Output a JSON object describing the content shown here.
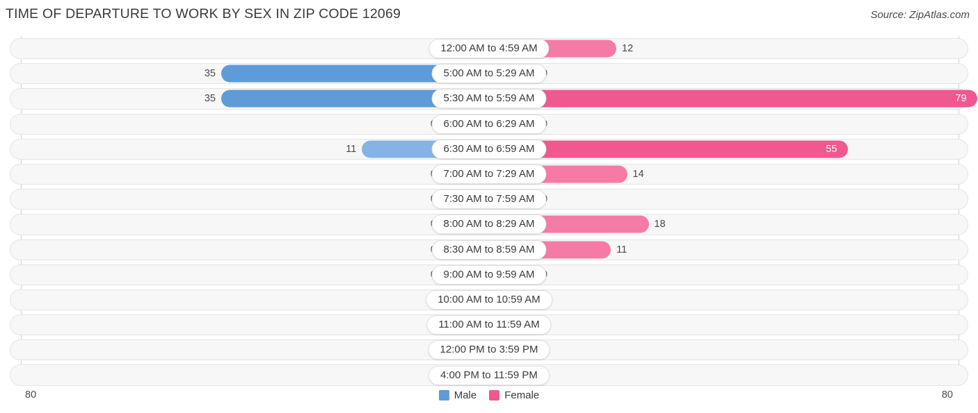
{
  "header": {
    "title": "TIME OF DEPARTURE TO WORK BY SEX IN ZIP CODE 12069",
    "source": "Source: ZipAtlas.com"
  },
  "legend": {
    "items": [
      {
        "label": "Male",
        "color": "#5E9BD8"
      },
      {
        "label": "Female",
        "color": "#F0588F"
      }
    ]
  },
  "axis": {
    "left_end": "80",
    "right_end": "80"
  },
  "colors": {
    "male_strong": "#5E9BD8",
    "male_light": "#A8C8EC",
    "female_strong": "#F0588F",
    "female_mid": "#F57BA6",
    "female_light": "#F9A8C4",
    "track": "#f7f7f7",
    "track_border": "#e4e4e4",
    "axis": "#cfcfcf"
  },
  "chart_data": {
    "type": "bar",
    "orientation": "horizontal",
    "style": "diverging-butterfly",
    "title": "TIME OF DEPARTURE TO WORK BY SEX IN ZIP CODE 12069",
    "xlabel": "",
    "ylabel": "",
    "xlim": [
      80,
      80
    ],
    "grid": false,
    "legend_position": "bottom-center",
    "categories": [
      "12:00 AM to 4:59 AM",
      "5:00 AM to 5:29 AM",
      "5:30 AM to 5:59 AM",
      "6:00 AM to 6:29 AM",
      "6:30 AM to 6:59 AM",
      "7:00 AM to 7:29 AM",
      "7:30 AM to 7:59 AM",
      "8:00 AM to 8:29 AM",
      "8:30 AM to 8:59 AM",
      "9:00 AM to 9:59 AM",
      "10:00 AM to 10:59 AM",
      "11:00 AM to 11:59 AM",
      "12:00 PM to 3:59 PM",
      "4:00 PM to 11:59 PM"
    ],
    "series": [
      {
        "name": "Male",
        "values": [
          0,
          35,
          35,
          0,
          11,
          0,
          0,
          0,
          0,
          0,
          0,
          0,
          0,
          0
        ]
      },
      {
        "name": "Female",
        "values": [
          12,
          0,
          79,
          0,
          55,
          14,
          0,
          18,
          11,
          0,
          0,
          0,
          0,
          0
        ]
      }
    ]
  },
  "rows": [
    {
      "category": "12:00 AM to 4:59 AM",
      "male": "0",
      "female": "12"
    },
    {
      "category": "5:00 AM to 5:29 AM",
      "male": "35",
      "female": "0"
    },
    {
      "category": "5:30 AM to 5:59 AM",
      "male": "35",
      "female": "79"
    },
    {
      "category": "6:00 AM to 6:29 AM",
      "male": "0",
      "female": "0"
    },
    {
      "category": "6:30 AM to 6:59 AM",
      "male": "11",
      "female": "55"
    },
    {
      "category": "7:00 AM to 7:29 AM",
      "male": "0",
      "female": "14"
    },
    {
      "category": "7:30 AM to 7:59 AM",
      "male": "0",
      "female": "0"
    },
    {
      "category": "8:00 AM to 8:29 AM",
      "male": "0",
      "female": "18"
    },
    {
      "category": "8:30 AM to 8:59 AM",
      "male": "0",
      "female": "11"
    },
    {
      "category": "9:00 AM to 9:59 AM",
      "male": "0",
      "female": "0"
    },
    {
      "category": "10:00 AM to 10:59 AM",
      "male": "0",
      "female": "0"
    },
    {
      "category": "11:00 AM to 11:59 AM",
      "male": "0",
      "female": "0"
    },
    {
      "category": "12:00 PM to 3:59 PM",
      "male": "0",
      "female": "0"
    },
    {
      "category": "4:00 PM to 11:59 PM",
      "male": "0",
      "female": "0"
    }
  ]
}
